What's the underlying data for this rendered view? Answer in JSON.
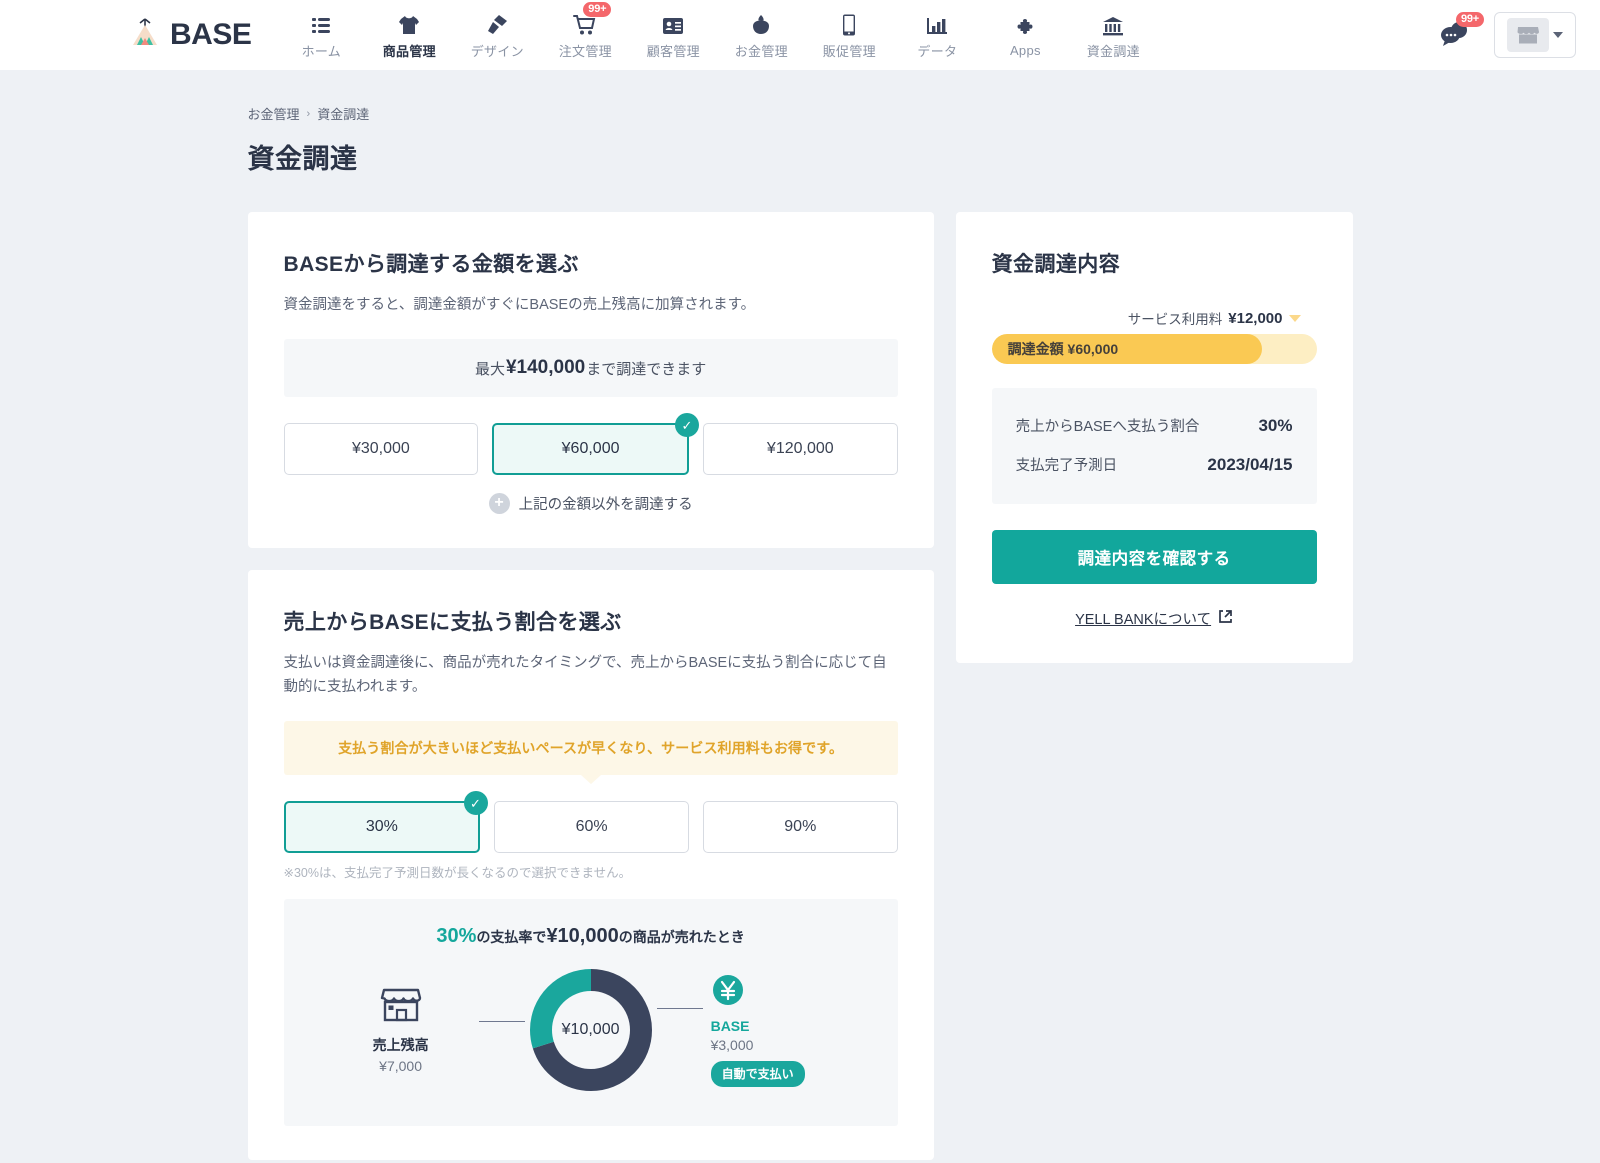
{
  "nav": {
    "brand": "BASE",
    "brand_icon": "tent-logo-icon",
    "items": [
      {
        "label": "ホーム",
        "icon": "list-icon",
        "badge": ""
      },
      {
        "label": "商品管理",
        "icon": "tshirt-icon",
        "badge": ""
      },
      {
        "label": "デザイン",
        "icon": "brush-icon",
        "badge": ""
      },
      {
        "label": "注文管理",
        "icon": "cart-icon",
        "badge": "99+"
      },
      {
        "label": "顧客管理",
        "icon": "id-card-icon",
        "badge": ""
      },
      {
        "label": "お金管理",
        "icon": "wallet-icon",
        "badge": ""
      },
      {
        "label": "販促管理",
        "icon": "smartphone-icon",
        "badge": ""
      },
      {
        "label": "データ",
        "icon": "bar-chart-icon",
        "badge": ""
      },
      {
        "label": "Apps",
        "icon": "puzzle-icon",
        "badge": ""
      },
      {
        "label": "資金調達",
        "icon": "bank-icon",
        "badge": ""
      }
    ],
    "active_index": 1,
    "chat_badge": "99+",
    "chat_icon": "chat-bubble-icon",
    "store_icon": "storefront-icon",
    "store_caret_icon": "chevron-down-icon"
  },
  "breadcrumb": {
    "parent": "お金管理",
    "separator": "›",
    "current": "資金調達"
  },
  "page_title": "資金調達",
  "amount_card": {
    "title": "BASEから調達する金額を選ぶ",
    "description": "資金調達をすると、調達金額がすぐにBASEの売上残高に加算されます。",
    "max_prefix": "最大",
    "max_amount": "¥140,000",
    "max_suffix": "まで調達できます",
    "options": [
      "¥30,000",
      "¥60,000",
      "¥120,000"
    ],
    "selected_index": 1,
    "other_link": "上記の金額以外を調達する",
    "other_icon": "plus-circle-icon",
    "check_icon": "check-icon"
  },
  "ratio_card": {
    "title": "売上からBASEに支払う割合を選ぶ",
    "description": "支払いは資金調達後に、商品が売れたタイミングで、売上からBASEに支払う割合に応じて自動的に支払われます。",
    "tip": "支払う割合が大きいほど支払いペースが早くなり、サービス利用料もお得です。",
    "options": [
      "30%",
      "60%",
      "90%"
    ],
    "selected_index": 0,
    "note": "※30%は、支払完了予測日数が長くなるので選択できません。",
    "check_icon": "check-icon",
    "sim": {
      "head_pct": "30%",
      "head_mid": "の支払率で",
      "head_amount": "¥10,000",
      "head_tail": "の商品が売れたとき",
      "center_value": "¥10,000",
      "left_icon": "storefront-icon",
      "left_title": "売上残高",
      "left_value": "¥7,000",
      "right_icon": "yen-circle-icon",
      "right_title": "BASE",
      "right_value": "¥3,000",
      "right_pill": "自動で支払い"
    }
  },
  "summary_card": {
    "title": "資金調達内容",
    "fee_label": "サービス利用料",
    "fee_value": "¥12,000",
    "bar_label": "調達金額",
    "bar_value": "¥60,000",
    "rows": [
      {
        "key": "売上からBASEへ支払う割合",
        "value": "30%"
      },
      {
        "key": "支払完了予測日",
        "value": "2023/04/15"
      }
    ],
    "cta": "調達内容を確認する",
    "link": "YELL BANKについて",
    "link_icon": "external-link-icon"
  },
  "chart_data": {
    "type": "pie",
    "title": "30%の支払率で¥10,000の商品が売れたとき",
    "categories": [
      "BASE",
      "売上残高"
    ],
    "values": [
      3000,
      7000
    ],
    "labels": [
      "¥3,000",
      "¥7,000"
    ],
    "percentages": [
      30,
      70
    ],
    "colors": [
      "#1aa79d",
      "#3b455e"
    ],
    "center_label": "¥10,000",
    "total": 10000,
    "legend_position": "sides",
    "donut": true
  },
  "colors": {
    "teal": "#12a79c",
    "navy": "#2b3447",
    "amber": "#fac953",
    "amber_light": "#fdeec3",
    "badge_red": "#f4676b",
    "page_bg": "#eef1f5"
  }
}
